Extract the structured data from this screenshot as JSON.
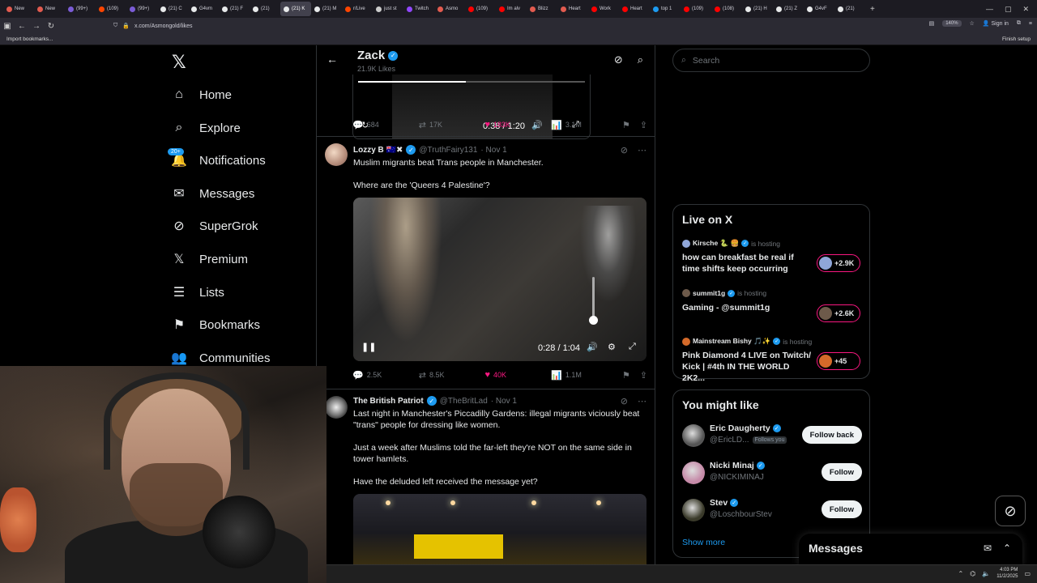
{
  "browser": {
    "tabs": [
      "New",
      "New",
      "(99+)",
      "(109)",
      "(99+)",
      "(21) C",
      "G4vm",
      "(21) F",
      "(21)",
      "(21) K",
      "(21) M",
      "r/Live",
      "just st",
      "Twitch",
      "Asmo",
      "(109)",
      "Im alv",
      "Blizz",
      "Heart",
      "Work",
      "Heart",
      "top 1",
      "(109)",
      "(108)",
      "(21) H",
      "(21) Z",
      "G4vF",
      "(21)"
    ],
    "active_tab_index": 9,
    "url": "x.com/Asmongold/likes",
    "zoom": "140%",
    "sign_in": "Sign in",
    "bookmark": "Import bookmarks...",
    "finish_setup": "Finish setup"
  },
  "sidebar": {
    "notif_badge": "20+",
    "items": [
      {
        "label": "Home",
        "icon": "home-icon",
        "glyph": "⌂"
      },
      {
        "label": "Explore",
        "icon": "search-icon",
        "glyph": "⌕"
      },
      {
        "label": "Notifications",
        "icon": "bell-icon",
        "glyph": "🔔"
      },
      {
        "label": "Messages",
        "icon": "mail-icon",
        "glyph": "✉"
      },
      {
        "label": "SuperGrok",
        "icon": "grok-icon",
        "glyph": "⊘"
      },
      {
        "label": "Premium",
        "icon": "x-premium-icon",
        "glyph": "𝕏"
      },
      {
        "label": "Lists",
        "icon": "list-icon",
        "glyph": "☰"
      },
      {
        "label": "Bookmarks",
        "icon": "bookmark-icon",
        "glyph": "⚑"
      },
      {
        "label": "Communities",
        "icon": "people-icon",
        "glyph": "👥"
      }
    ]
  },
  "header": {
    "name": "Zack",
    "sub": "21.9K Likes"
  },
  "video1": {
    "time": "0:38 / 1:20",
    "progress": 0.475
  },
  "tweet0_stats": {
    "replies": "684",
    "reposts": "17K",
    "likes": "183K",
    "views": "3.1M"
  },
  "tweet1": {
    "name": "Lozzy B 🇦🇺✖",
    "handle": "@TruthFairy131",
    "date": "· Nov 1",
    "line1": "Muslim migrants beat Trans people in Manchester.",
    "line2": "Where are the 'Queers 4 Palestine'?",
    "video_time": "0:28 / 1:04",
    "stats": {
      "replies": "2.5K",
      "reposts": "8.5K",
      "likes": "40K",
      "views": "1.1M"
    }
  },
  "tweet2": {
    "name": "The British Patriot",
    "handle": "@TheBritLad",
    "date": "· Nov 1",
    "p1": "Last night in Manchester's Piccadilly Gardens: illegal migrants viciously beat \"trans\" people for dressing like women.",
    "p2": "Just a week after Muslims told the far-left they're NOT on the same side in tower hamlets.",
    "p3": "Have the deluded left received the message yet?"
  },
  "right": {
    "search_placeholder": "Search",
    "live_title": "Live on X",
    "live": [
      {
        "host": "Kirsche 🐍 🍔",
        "suffix": "is hosting",
        "title": "how can breakfast be real if time shifts keep occurring",
        "count": "+2.9K",
        "color": "#8fa6d8"
      },
      {
        "host": "summit1g",
        "suffix": "is hosting",
        "title": "Gaming - @summit1g",
        "count": "+2.6K",
        "color": "#6d5a4a"
      },
      {
        "host": "Mainstream Bishy 🎵✨",
        "suffix": "is hosting",
        "title": "Pink Diamond 4 LIVE on Twitch/ Kick | #4th IN THE WORLD 2K2...",
        "count": "+45",
        "color": "#d46a2a"
      }
    ],
    "might_like_title": "You might like",
    "suggestions": [
      {
        "name": "Eric Daugherty",
        "handle": "@EricLD...",
        "follows_you": "Follows you",
        "button": "Follow back",
        "color": "#555"
      },
      {
        "name": "Nicki Minaj",
        "handle": "@NICKIMINAJ",
        "follows_you": "",
        "button": "Follow",
        "color": "#c58aa8"
      },
      {
        "name": "Stev",
        "handle": "@LoschbourStev",
        "follows_you": "",
        "button": "Follow",
        "color": "#3a3a2a"
      }
    ],
    "show_more": "Show more"
  },
  "messages_drawer": {
    "title": "Messages"
  },
  "taskbar": {
    "time": "4:03 PM",
    "date": "11/2/2025"
  }
}
